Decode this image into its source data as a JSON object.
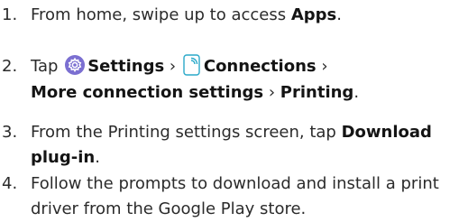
{
  "steps": [
    {
      "number": "1.",
      "line1_pre": "From home, swipe up to access ",
      "line1_bold": "Apps",
      "line1_post": "."
    },
    {
      "number": "2.",
      "tap": "Tap",
      "settings": "Settings",
      "sep1": "›",
      "connections": "Connections",
      "sep2": "›",
      "more": "More connection settings",
      "sep3": "›",
      "printing": "Printing",
      "end": "."
    },
    {
      "number": "3.",
      "line1_pre": "From the Printing settings screen, tap ",
      "line1_bold": "Download",
      "line2_bold": "plug-in",
      "line2_post": "."
    },
    {
      "number": "4.",
      "line1": "Follow the prompts to download and install a print",
      "line2": "driver from the Google Play store."
    }
  ],
  "icons": {
    "settings_icon": "gear-icon",
    "connections_icon": "connections-icon",
    "settings_color": "#7b6fd1",
    "connections_color": "#2aa9c9"
  }
}
